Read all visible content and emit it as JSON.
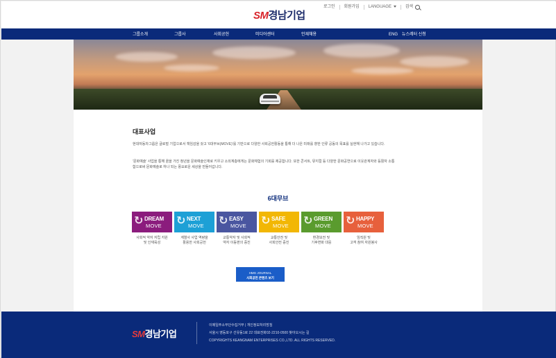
{
  "header": {
    "logo_sm": "SM",
    "logo_name": "경남기업",
    "util": {
      "login": "로그인",
      "join": "회원가입",
      "language": "LANGUAGE",
      "search": "검색"
    }
  },
  "nav": {
    "items": [
      "그룹소개",
      "그룹사",
      "사회공헌",
      "미디어센터",
      "인재채용"
    ],
    "eng": "ENG",
    "newsletter": "뉴스레터 신청"
  },
  "main": {
    "section_title": "대표사업",
    "para1": "현대자동차그룹은 글로벌 기업으로서 책임감을 갖고 '6대무브(MOVE)'를 기반으로 다양한 사회공헌활동을 통해 더 나은 미래를 향한 인류 공동의 목표를 실현해 나가고 있습니다.",
    "para2": "'문화예술' 사업을 통해 꿈을 가진 청년을 문화예술인재로 키우고 소외계층에게는 문화체험의 기회를 제공합니다. 또한 콘서트, 뮤지컬 등 다양한 문화공연으로 이웃관계자와 등활자 소통함으로써 문화예술로 하나 되는 풍요로운 세상을 만들어갑니다.",
    "six_title": "6대무브",
    "moves": [
      {
        "w1": "DREAM",
        "w2": "MOVE",
        "color": "#8b1c7d",
        "cap1": "사회적 약자 자립 지원",
        "cap2": "및 인재육성"
      },
      {
        "w1": "NEXT",
        "w2": "MOVE",
        "color": "#1da0d6",
        "cap1": "계열사 사업 역량을",
        "cap2": "활용한 사회공헌"
      },
      {
        "w1": "EASY",
        "w2": "MOVE",
        "color": "#4a56a0",
        "cap1": "교통약자 및 사회적",
        "cap2": "약자 이동편의 증진"
      },
      {
        "w1": "SAFE",
        "w2": "MOVE",
        "color": "#f2b705",
        "cap1": "교통안전 및",
        "cap2": "사회안전 증진"
      },
      {
        "w1": "GREEN",
        "w2": "MOVE",
        "color": "#5a9b2e",
        "cap1": "환경보전 및",
        "cap2": "기후변화 대응"
      },
      {
        "w1": "HAPPY",
        "w2": "MOVE",
        "color": "#e7603c",
        "cap1": "임직원 및",
        "cap2": "고객 참여 자원봉사"
      }
    ],
    "journal_line1": "HMG JOURNAL",
    "journal_line2": "사회공헌 콘텐츠 보기"
  },
  "footer": {
    "logo_sm": "SM",
    "logo_name": "경남기업",
    "line1": "이메일주소무단수집거부 | 개인정보처리방침",
    "line2": "서울시 영등포구 선유동1로 22   대표전화02-2210-0500  찾아오시는 길",
    "line3": "COPYRIGHTS KEANGNAM  ENTERPRISES CO.,LTD. ALL  RIGHTS RESERVED."
  }
}
